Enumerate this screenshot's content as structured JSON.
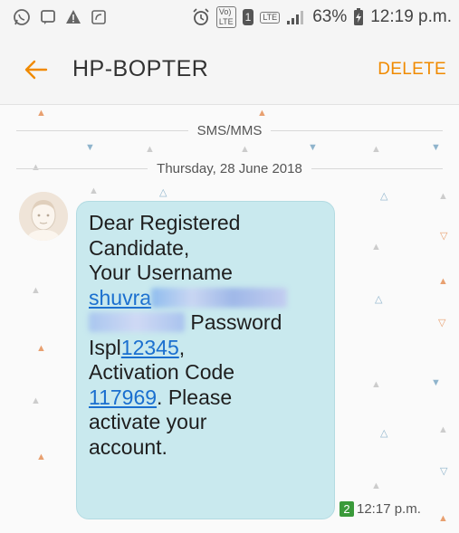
{
  "status_bar": {
    "icons": [
      "whatsapp-icon",
      "notification-icon",
      "warning-icon",
      "screenshot-icon"
    ],
    "volte_label": "Vo)",
    "lte_small": "LTE",
    "sim_label": "1",
    "lte_label": "LTE",
    "battery_percent": "63%",
    "time": "12:19 p.m."
  },
  "app_bar": {
    "title": "HP-BOPTER",
    "delete_label": "DELETE"
  },
  "thread": {
    "channel_label": "SMS/MMS",
    "date_label": "Thursday, 28 June 2018"
  },
  "message": {
    "line1": "Dear Registered",
    "line2": "Candidate,",
    "line3": "Your Username",
    "username_part": "shuvra",
    "password_label": " Password",
    "password_prefix": "Ispl",
    "password_link": "12345",
    "password_suffix": ",",
    "line7": "Activation Code",
    "activation_code": "117969",
    "activation_suffix": ". Please",
    "line9": "activate your",
    "line10": "account.",
    "sim_slot": "2",
    "time": "12:17 p.m."
  },
  "colors": {
    "accent": "#f08a00",
    "bubble": "#c9e9ee",
    "link": "#1a6fcf",
    "sim_badge": "#3a9a3a"
  }
}
